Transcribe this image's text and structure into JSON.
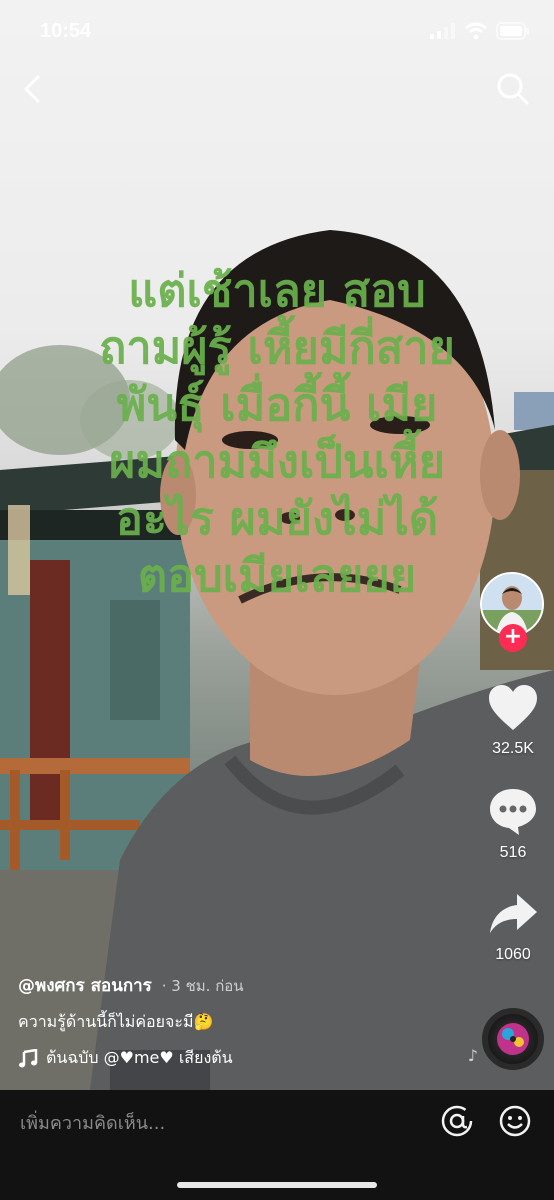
{
  "status": {
    "time": "10:54"
  },
  "overlay": {
    "lines": [
      "แต่เช้าเลย สอบ",
      "ถามผู้รู้ เหี้ยมีกี่สาย",
      "พันธุ์ เมื่อกี้นี้ เมีย",
      "ผมถามมึงเป็นเหี้ย",
      "อะไร ผมยังไม่ได้",
      "ตอบเมียเลยยย"
    ],
    "color": "#6ab04c"
  },
  "actions": {
    "likes": "32.5K",
    "comments": "516",
    "shares": "1060",
    "follow_symbol": "+"
  },
  "post": {
    "author": "@พงศกร สอนการ",
    "time": "· 3 ชม. ก่อน",
    "caption": "ความรู้ด้านนี้ก็ไม่ค่อยจะมี🤔",
    "music": "ต้นฉบับ   @♥me♥ เสียงต้น"
  },
  "comment_bar": {
    "placeholder": "เพิ่มความคิดเห็น..."
  },
  "colors": {
    "accent": "#fe2c55",
    "overlay_text": "#6ab04c",
    "bar_bg": "#121212"
  },
  "icons": [
    "back-icon",
    "search-icon",
    "heart-icon",
    "comment-icon",
    "share-icon",
    "music-note-icon",
    "at-icon",
    "emoji-icon"
  ]
}
